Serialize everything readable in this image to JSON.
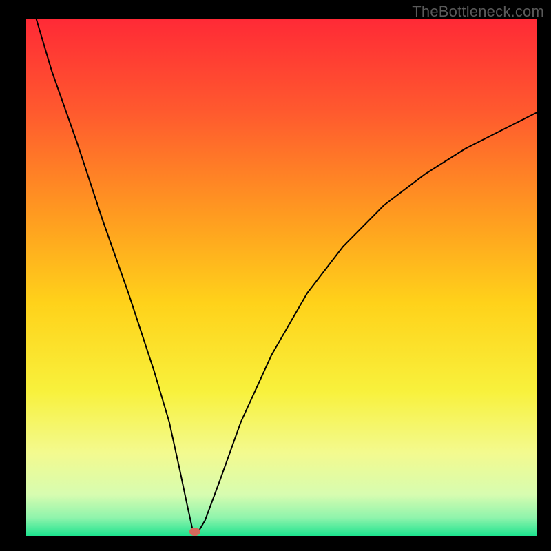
{
  "watermark": "TheBottleneck.com",
  "chart_data": {
    "type": "line",
    "title": "",
    "xlabel": "",
    "ylabel": "",
    "xlim": [
      0,
      100
    ],
    "ylim": [
      0,
      100
    ],
    "legend": false,
    "grid": false,
    "background_gradient": {
      "stops": [
        {
          "offset": 0.0,
          "color": "#ff2a36"
        },
        {
          "offset": 0.18,
          "color": "#ff5a2e"
        },
        {
          "offset": 0.38,
          "color": "#ff9b20"
        },
        {
          "offset": 0.55,
          "color": "#ffd21a"
        },
        {
          "offset": 0.72,
          "color": "#f8f13c"
        },
        {
          "offset": 0.84,
          "color": "#f3fa8f"
        },
        {
          "offset": 0.92,
          "color": "#d7fcb0"
        },
        {
          "offset": 0.965,
          "color": "#8ff4ac"
        },
        {
          "offset": 1.0,
          "color": "#1ee38f"
        }
      ]
    },
    "series": [
      {
        "name": "bottleneck-curve",
        "stroke": "#000000",
        "stroke_width": 2,
        "x": [
          2,
          5,
          10,
          15,
          20,
          25,
          28,
          30,
          31.5,
          32.5,
          33.5,
          35,
          38,
          42,
          48,
          55,
          62,
          70,
          78,
          86,
          94,
          100
        ],
        "values": [
          100,
          90,
          76,
          61,
          47,
          32,
          22,
          13,
          6,
          1.5,
          0.5,
          3,
          11,
          22,
          35,
          47,
          56,
          64,
          70,
          75,
          79,
          82
        ]
      }
    ],
    "marker": {
      "name": "min-point",
      "x": 33,
      "y": 0.8,
      "color": "#d5695c",
      "rx": 8,
      "ry": 6
    }
  }
}
